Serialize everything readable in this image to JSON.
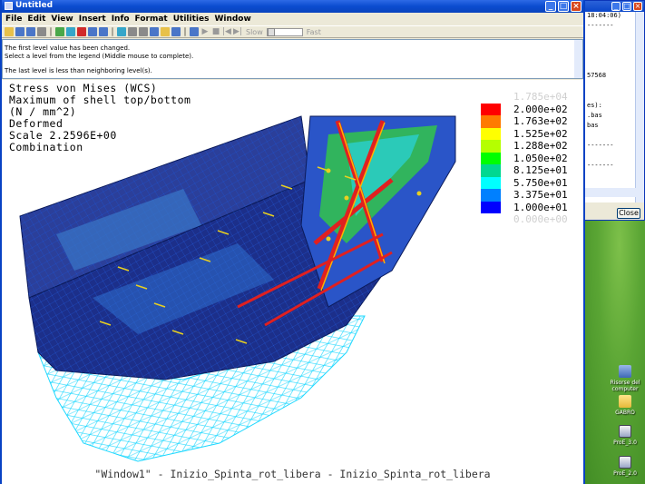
{
  "app": {
    "title": "Untitled",
    "menu": [
      "File",
      "Edit",
      "View",
      "Insert",
      "Info",
      "Format",
      "Utilities",
      "Window"
    ],
    "toolbar": {
      "slider_left_label": "Slow",
      "slider_right_label": "Fast"
    },
    "messages": [
      "The first level value has been changed.",
      "Select a level from the legend (Middle mouse to complete).",
      "",
      "The last level is less than neighboring level(s)."
    ]
  },
  "viewport": {
    "header": [
      "Stress von Mises (WCS)",
      "Maximum of shell top/bottom",
      "(N / mm^2)",
      "Deformed",
      "Scale   2.2596E+00",
      "Combination"
    ],
    "legend": [
      {
        "value": "1.785e+04",
        "color": "#ffffff",
        "faded": true
      },
      {
        "value": "2.000e+02",
        "color": "#ff0000"
      },
      {
        "value": "1.763e+02",
        "color": "#ff7a00"
      },
      {
        "value": "1.525e+02",
        "color": "#ffff00"
      },
      {
        "value": "1.288e+02",
        "color": "#b5ff00"
      },
      {
        "value": "1.050e+02",
        "color": "#00ff00"
      },
      {
        "value": "8.125e+01",
        "color": "#00d890"
      },
      {
        "value": "5.750e+01",
        "color": "#00ffff"
      },
      {
        "value": "3.375e+01",
        "color": "#0080ff"
      },
      {
        "value": "1.000e+01",
        "color": "#0000ff"
      },
      {
        "value": "0.000e+00",
        "color": "#1a1a70",
        "faded": true
      }
    ],
    "footer": "\"Window1\" - Inizio_Spinta_rot_libera - Inizio_Spinta_rot_libera"
  },
  "background_window": {
    "lines": [
      "18:04:06)",
      "-------",
      "",
      "",
      "",
      "",
      "57568",
      "",
      "",
      "es):",
      ".bas",
      "bas",
      "",
      "-------",
      "",
      "-------"
    ],
    "close_label": "Close"
  },
  "desktop_icons": [
    {
      "label": "Risorse del computer",
      "icon": "computer-icon"
    },
    {
      "label": "GABRO",
      "icon": "folder-icon"
    },
    {
      "label": "ProE_3.0",
      "icon": "program-icon"
    },
    {
      "label": "ProE_2.0",
      "icon": "program-icon"
    }
  ]
}
